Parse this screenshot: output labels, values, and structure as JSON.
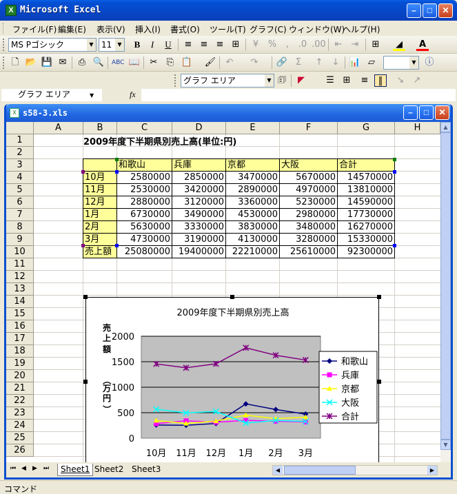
{
  "app": {
    "title": "Microsoft Excel",
    "workbook_name": "s58-3.xls",
    "status": "コマンド"
  },
  "menu": [
    "ファイル(F)",
    "編集(E)",
    "表示(V)",
    "挿入(I)",
    "書式(O)",
    "ツール(T)",
    "グラフ(C)",
    "ウィンドウ(W)",
    "ヘルプ(H)"
  ],
  "toolbar": {
    "font_name": "MS Pゴシック",
    "font_size": "11",
    "chart_object": "グラフ エリア"
  },
  "formula_bar": {
    "name_box": "グラフ エリア",
    "fx": "fx"
  },
  "columns": [
    "A",
    "B",
    "C",
    "D",
    "E",
    "F",
    "G",
    "H"
  ],
  "rows": [
    "1",
    "2",
    "3",
    "4",
    "5",
    "6",
    "7",
    "8",
    "9",
    "10",
    "11",
    "12",
    "13",
    "14",
    "15",
    "16",
    "17",
    "18",
    "19",
    "20",
    "21",
    "22",
    "23",
    "24",
    "25",
    "26"
  ],
  "sheet": {
    "title": "2009年度下半期県別売上高(単位:円)",
    "header": [
      "和歌山",
      "兵庫",
      "京都",
      "大阪",
      "合計"
    ],
    "rows": [
      {
        "label": "10月",
        "values": [
          "2580000",
          "2850000",
          "3470000",
          "5670000",
          "14570000"
        ]
      },
      {
        "label": "11月",
        "values": [
          "2530000",
          "3420000",
          "2890000",
          "4970000",
          "13810000"
        ]
      },
      {
        "label": "12月",
        "values": [
          "2880000",
          "3120000",
          "3360000",
          "5230000",
          "14590000"
        ]
      },
      {
        "label": "1月",
        "values": [
          "6730000",
          "3490000",
          "4530000",
          "2980000",
          "17730000"
        ]
      },
      {
        "label": "2月",
        "values": [
          "5630000",
          "3330000",
          "3830000",
          "3480000",
          "16270000"
        ]
      },
      {
        "label": "3月",
        "values": [
          "4730000",
          "3190000",
          "4130000",
          "3280000",
          "15330000"
        ]
      }
    ],
    "total": {
      "label": "売上額",
      "values": [
        "25080000",
        "19400000",
        "22210000",
        "25610000",
        "92300000"
      ]
    }
  },
  "tabs": [
    "Sheet1",
    "Sheet2",
    "Sheet3"
  ],
  "chart_data": {
    "type": "line",
    "title": "2009年度下半期県別売上高",
    "ylabel": "売上額（万円）",
    "ylabel_chars": [
      "売",
      "上",
      "額",
      "（",
      "万",
      "円",
      "）"
    ],
    "xlabel": "",
    "categories": [
      "10月",
      "11月",
      "12月",
      "1月",
      "2月",
      "3月"
    ],
    "yticks": [
      "0",
      "500",
      "1000",
      "1500",
      "2000"
    ],
    "ylim": [
      0,
      2000
    ],
    "grid": true,
    "legend": "right",
    "series": [
      {
        "name": "和歌山",
        "values": [
          258,
          253,
          288,
          673,
          563,
          473
        ],
        "color": "#000080",
        "marker": "diamond"
      },
      {
        "name": "兵庫",
        "values": [
          285,
          342,
          312,
          349,
          333,
          319
        ],
        "color": "#ff00ff",
        "marker": "square"
      },
      {
        "name": "京都",
        "values": [
          347,
          289,
          336,
          453,
          383,
          413
        ],
        "color": "#ffff00",
        "marker": "triangle"
      },
      {
        "name": "大阪",
        "values": [
          567,
          497,
          523,
          298,
          348,
          328
        ],
        "color": "#00ffff",
        "marker": "x"
      },
      {
        "name": "合計",
        "values": [
          1457,
          1381,
          1459,
          1773,
          1627,
          1533
        ],
        "color": "#800080",
        "marker": "star"
      }
    ],
    "plot_bg": "#c0c0c0"
  },
  "colors": {
    "title_blue": "#0550d4",
    "table_fill": "#ffff99"
  }
}
